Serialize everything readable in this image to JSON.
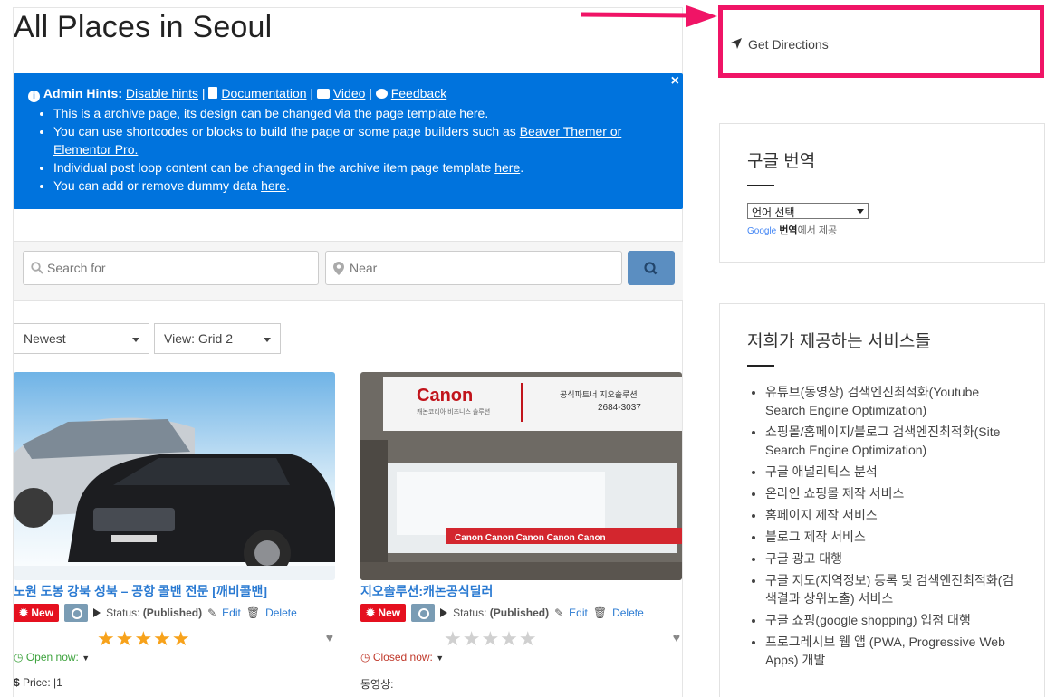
{
  "page": {
    "title": "All Places in Seoul"
  },
  "hints": {
    "heading": "Admin Hints:",
    "disable_label": "Disable hints",
    "doc_label": "Documentation",
    "video_label": "Video",
    "feedback_label": "Feedback",
    "close_label": "×",
    "items": [
      {
        "text": "This is a archive page, its design can be changed via the page template ",
        "link": "here",
        "end": "."
      },
      {
        "text": "You can use shortcodes or blocks to build the page or some page builders such as ",
        "link": "Beaver Themer or Elementor Pro.",
        "end": ""
      },
      {
        "text": "Individual post loop content can be changed in the archive item page template ",
        "link": "here",
        "end": "."
      },
      {
        "text": "You can add or remove dummy data ",
        "link": "here",
        "end": "."
      }
    ]
  },
  "search": {
    "search_placeholder": "Search for",
    "near_placeholder": "Near"
  },
  "sort": {
    "selected": "Newest"
  },
  "view": {
    "selected": "View: Grid 2"
  },
  "listings": [
    {
      "title": "노원 도봉 강북 성북 – 공항 콜밴 전문 [깨비콜밴]",
      "badge": "New",
      "status_label": "Status: ",
      "status_value": "(Published)",
      "edit": "Edit",
      "delete": "Delete",
      "rating": 5,
      "hours": "Open now:",
      "price": "Price: |1"
    },
    {
      "title": "지오솔루션:캐논공식딜러",
      "badge": "New",
      "status_label": "Status: ",
      "status_value": "(Published)",
      "edit": "Edit",
      "delete": "Delete",
      "rating": 0,
      "hours": "Closed now:",
      "video_label": "동영상:",
      "sign_brand": "Canon",
      "sign_partner": "공식파트너 지오솔루션",
      "sign_phone": "2684-3037",
      "sign_sub": "캐논코리아 비즈니스 솔루션"
    }
  ],
  "sidebar": {
    "directions_label": "Get Directions",
    "translate": {
      "title": "구글 번역",
      "select": "언어 선택",
      "provider_prefix": "Google",
      "provider_bold": "번역",
      "provider_suffix": "에서 제공"
    },
    "services": {
      "title": "저희가 제공하는 서비스들",
      "items": [
        "유튜브(동영상) 검색엔진최적화(Youtube Search Engine Optimization)",
        "쇼핑몰/홈페이지/블로그 검색엔진최적화(Site Search Engine Optimization)",
        "구글 애널리틱스 분석",
        "온라인 쇼핑몰 제작 서비스",
        "홈페이지 제작 서비스",
        "블로그 제작 서비스",
        "구글 광고 대행",
        "구글 지도(지역정보) 등록 및 검색엔진최적화(검색결과 상위노출) 서비스",
        "구글 쇼핑(google shopping) 입점 대행",
        "프로그레시브 웹 앱 (PWA, Progressive Web Apps) 개발"
      ]
    }
  },
  "colors": {
    "accent": "#0073dd",
    "highlight": "#f01466",
    "star": "#f7a21b",
    "star_empty": "#d0d0d0",
    "new_badge": "#e5101f"
  }
}
